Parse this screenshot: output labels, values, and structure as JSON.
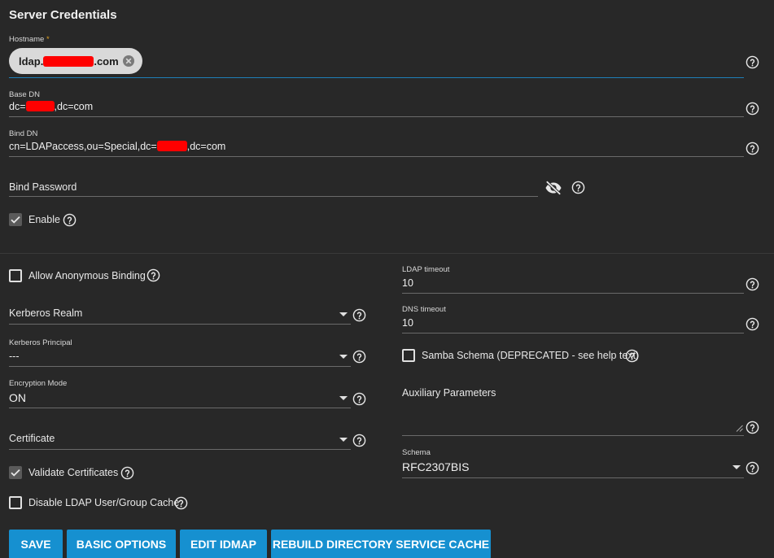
{
  "section": {
    "title": "Server Credentials"
  },
  "hostname": {
    "label": "Hostname",
    "required_mark": "*",
    "chip_prefix": "ldap.",
    "chip_suffix": ".com"
  },
  "base_dn": {
    "label": "Base DN",
    "value_prefix": "dc=",
    "value_suffix": ",dc=com"
  },
  "bind_dn": {
    "label": "Bind DN",
    "value_prefix": "cn=LDAPaccess,ou=Special,dc=",
    "value_suffix": ",dc=com"
  },
  "bind_password": {
    "placeholder": "Bind Password"
  },
  "enable": {
    "label": "Enable",
    "checked": true
  },
  "allow_anonymous": {
    "label": "Allow Anonymous Binding",
    "checked": false
  },
  "kerberos_realm": {
    "placeholder": "Kerberos Realm"
  },
  "kerberos_principal": {
    "label": "Kerberos Principal",
    "value": "---"
  },
  "encryption_mode": {
    "label": "Encryption Mode",
    "value": "ON"
  },
  "certificate": {
    "placeholder": "Certificate"
  },
  "validate_certificates": {
    "label": "Validate Certificates",
    "checked": true
  },
  "disable_cache": {
    "label": "Disable LDAP User/Group Cache",
    "checked": false
  },
  "ldap_timeout": {
    "label": "LDAP timeout",
    "value": "10"
  },
  "dns_timeout": {
    "label": "DNS timeout",
    "value": "10"
  },
  "samba_schema": {
    "label": "Samba Schema (DEPRECATED - see help text)",
    "checked": false
  },
  "auxiliary_parameters": {
    "placeholder": "Auxiliary Parameters"
  },
  "schema": {
    "label": "Schema",
    "value": "RFC2307BIS"
  },
  "buttons": {
    "save": "SAVE",
    "basic_options": "BASIC OPTIONS",
    "edit_idmap": "EDIT IDMAP",
    "rebuild_cache": "REBUILD DIRECTORY SERVICE CACHE"
  },
  "colors": {
    "background": "#282828",
    "accent": "#1690d0",
    "focus_line": "#1f7fb8",
    "redaction": "#ff0000"
  }
}
